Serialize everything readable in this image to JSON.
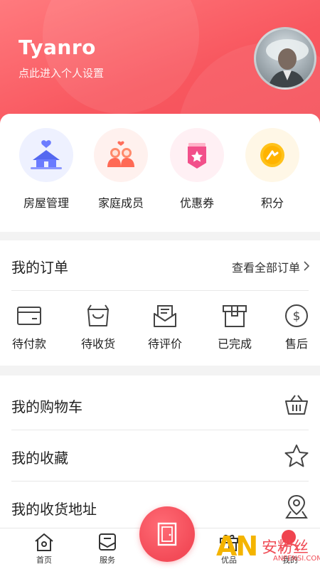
{
  "profile": {
    "username": "Tyanro",
    "subtitle": "点此进入个人设置"
  },
  "quick_links": [
    {
      "label": "房屋管理",
      "icon": "house-icon",
      "bg": "#eef1ff"
    },
    {
      "label": "家庭成员",
      "icon": "family-icon",
      "bg": "#fff1ee"
    },
    {
      "label": "优惠券",
      "icon": "coupon-icon",
      "bg": "#fff0f4"
    },
    {
      "label": "积分",
      "icon": "points-icon",
      "bg": "#fff7e6"
    }
  ],
  "orders": {
    "title": "我的订单",
    "view_all": "查看全部订单",
    "statuses": [
      {
        "label": "待付款",
        "icon": "wallet-icon"
      },
      {
        "label": "待收货",
        "icon": "bag-icon"
      },
      {
        "label": "待评价",
        "icon": "review-envelope-icon"
      },
      {
        "label": "已完成",
        "icon": "box-icon"
      },
      {
        "label": "售后",
        "icon": "dollar-circle-icon"
      }
    ]
  },
  "menu": [
    {
      "label": "我的购物车",
      "icon": "basket-icon"
    },
    {
      "label": "我的收藏",
      "icon": "star-icon"
    },
    {
      "label": "我的收货地址",
      "icon": "location-pin-icon"
    }
  ],
  "tabbar": {
    "tabs": [
      {
        "label": "首页",
        "icon": "home-icon"
      },
      {
        "label": "服务",
        "icon": "service-icon"
      },
      {
        "label": "优品",
        "icon": "gift-icon"
      },
      {
        "label": "我的",
        "icon": "user-icon"
      }
    ],
    "center_icon": "door-icon"
  },
  "watermark": {
    "logo": "AN",
    "text": "安粉丝",
    "url": "ANFENSI.COM"
  },
  "colors": {
    "accent": "#f4525c",
    "header_gradient_start": "#ff7a7e",
    "header_gradient_end": "#f44f5a"
  }
}
